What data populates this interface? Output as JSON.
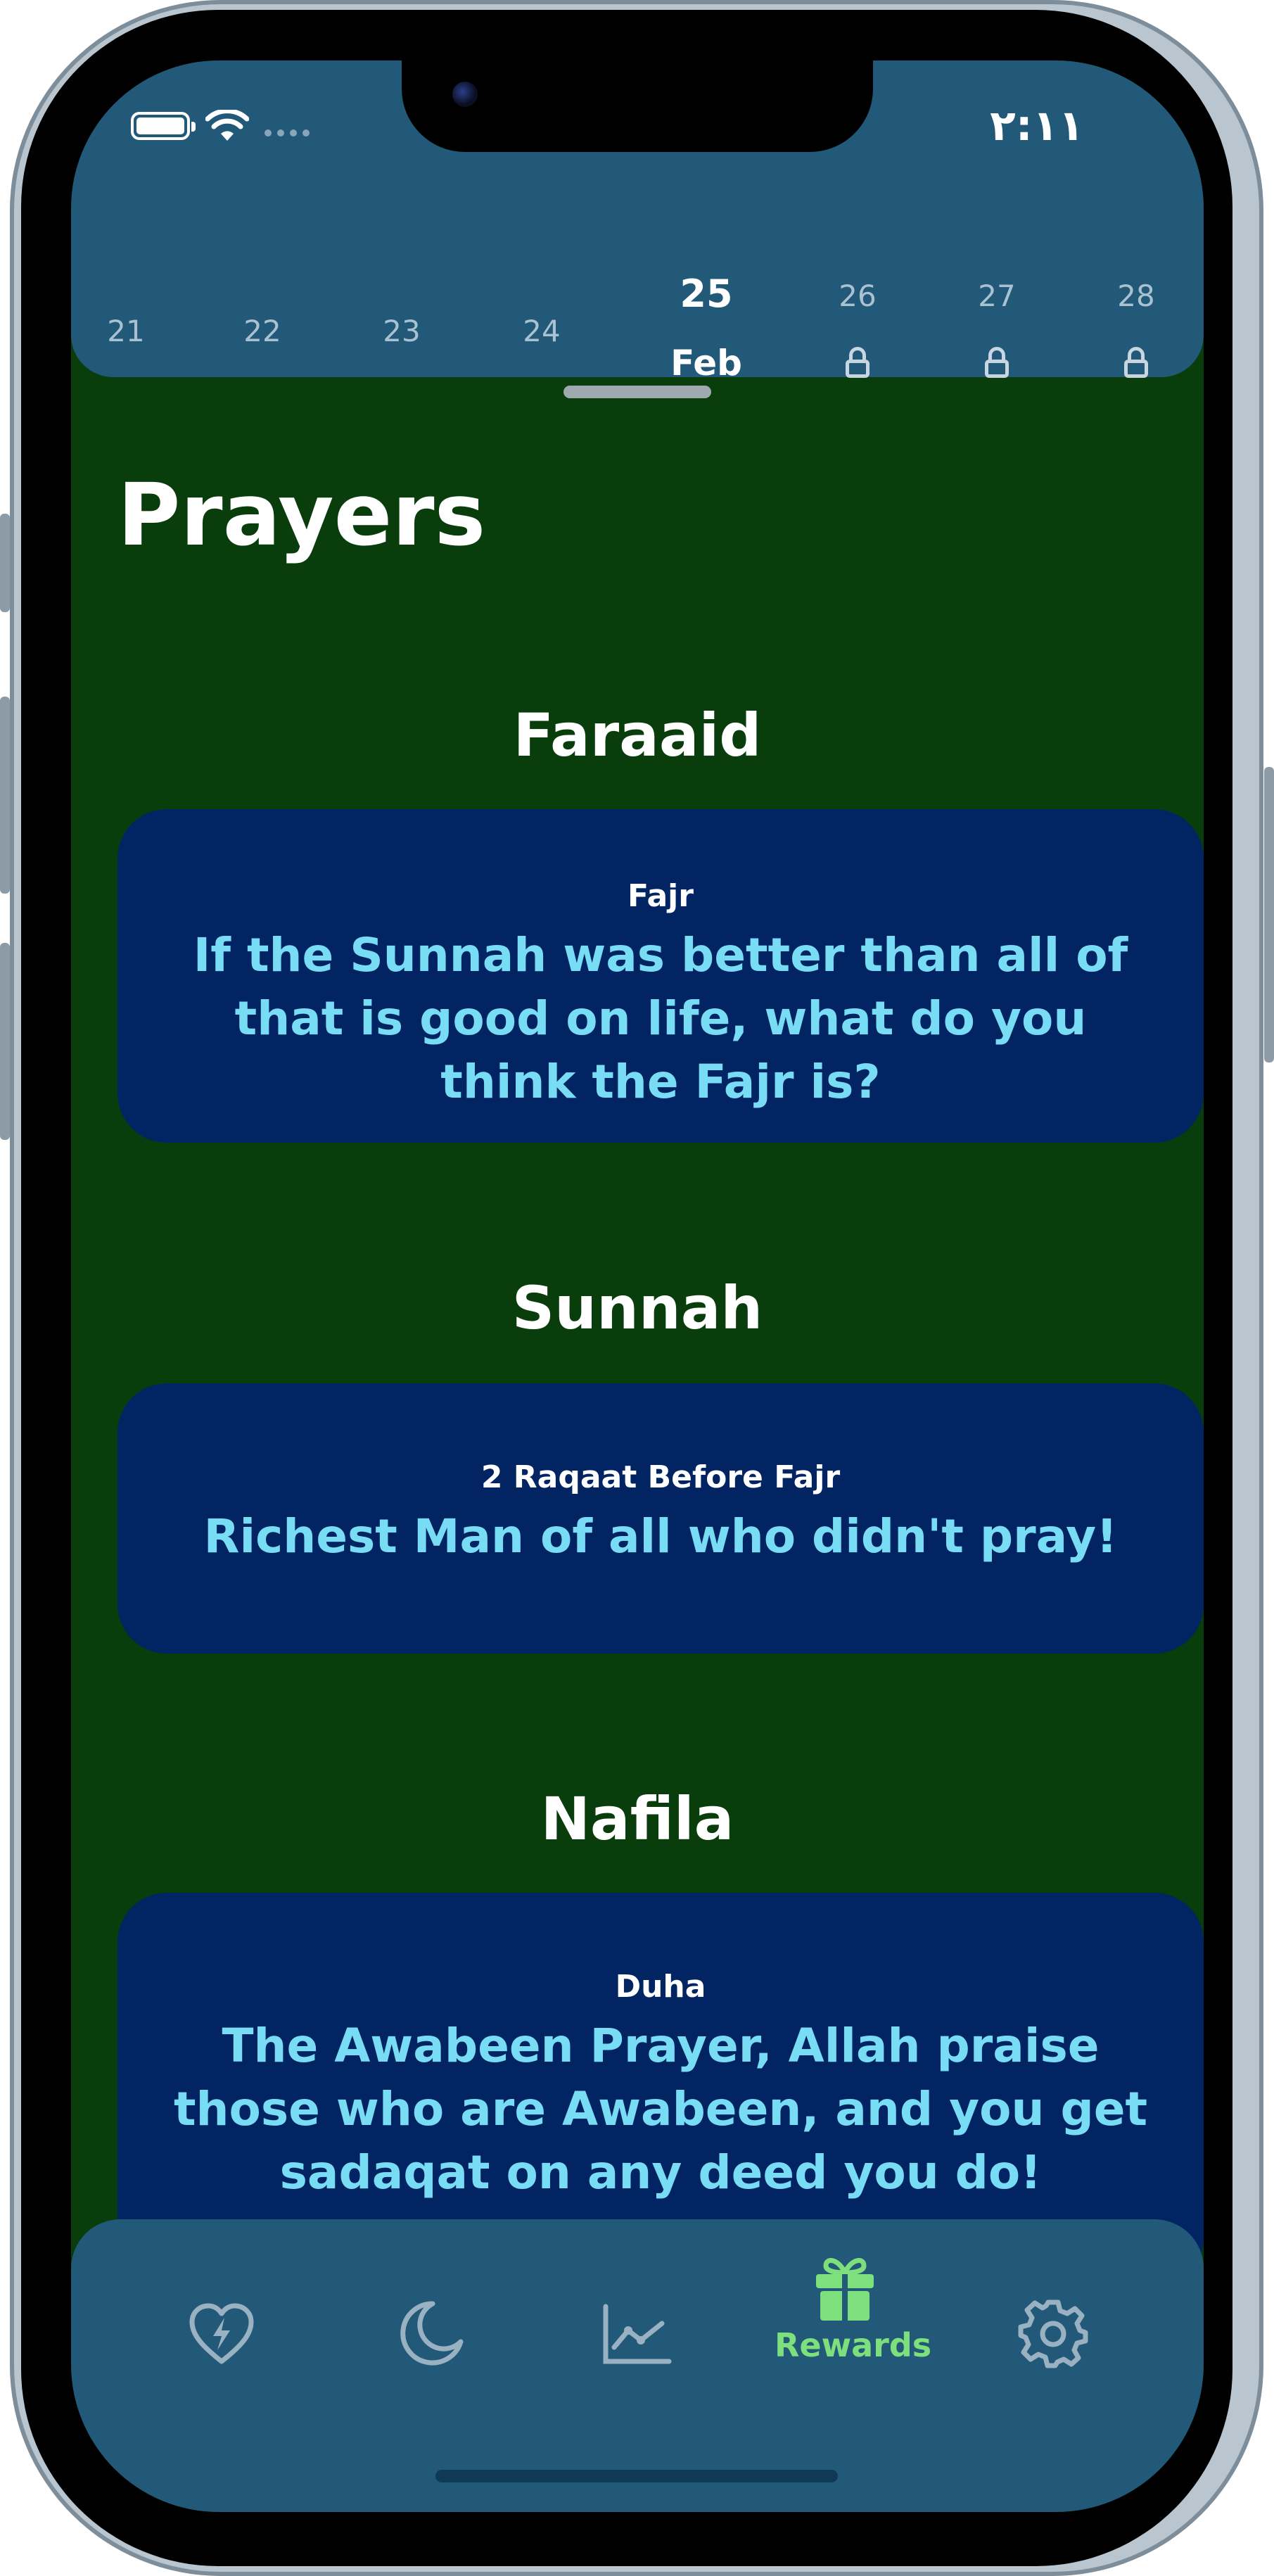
{
  "status_bar": {
    "time": "٢:١١",
    "icons": [
      "battery-icon",
      "wifi-icon",
      "cellular-dots-icon"
    ]
  },
  "date_strip": {
    "days": [
      {
        "day": "21",
        "locked": false
      },
      {
        "day": "22",
        "locked": false
      },
      {
        "day": "23",
        "locked": false
      },
      {
        "day": "24",
        "locked": false
      },
      {
        "day": "25",
        "month": "Feb",
        "selected": true
      },
      {
        "day": "26",
        "locked": true
      },
      {
        "day": "27",
        "locked": true
      },
      {
        "day": "28",
        "locked": true
      }
    ]
  },
  "page": {
    "title": "Prayers"
  },
  "sections": [
    {
      "title": "Faraaid",
      "card": {
        "label": "Fajr",
        "text": "If the Sunnah was better than all of that is good on life, what do you think the Fajr is?"
      }
    },
    {
      "title": "Sunnah",
      "card": {
        "label": "2 Raqaat Before Fajr",
        "text": "Richest Man of all who didn't pray!"
      }
    },
    {
      "title": "Nafila",
      "card": {
        "label": "Duha",
        "text": "The Awabeen Prayer, Allah praise those who are Awabeen, and you get sadaqat on any deed you do!"
      }
    }
  ],
  "tab_bar": {
    "tabs": [
      {
        "icon": "heart-bolt-icon",
        "label": "",
        "active": false
      },
      {
        "icon": "moon-icon",
        "label": "",
        "active": false
      },
      {
        "icon": "chart-line-icon",
        "label": "",
        "active": false
      },
      {
        "icon": "gift-icon",
        "label": "Rewards",
        "active": true
      },
      {
        "icon": "gear-icon",
        "label": "",
        "active": false
      }
    ]
  },
  "colors": {
    "background": "#093d0c",
    "header": "#225878",
    "card": "#022462",
    "card_text": "#79dcf5",
    "active_tab": "#7ee07c"
  }
}
